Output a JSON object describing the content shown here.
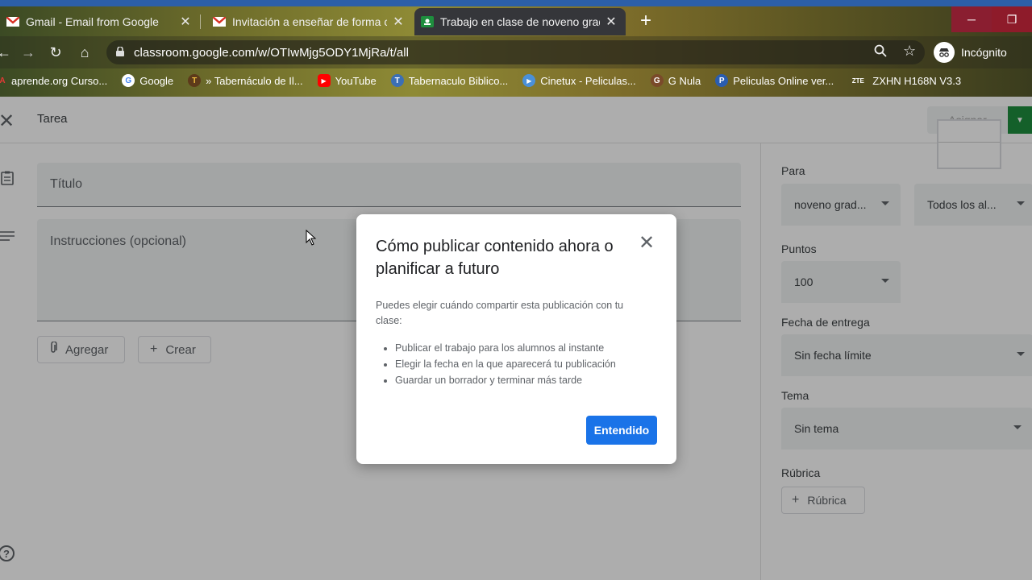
{
  "browser": {
    "tabs": [
      {
        "label": "Gmail - Email from Google",
        "icon": "gmail-icon",
        "close": "✕"
      },
      {
        "label": "Invitación a enseñar de forma co",
        "icon": "gmail-icon",
        "close": "✕"
      },
      {
        "label": "Trabajo en clase de noveno grad",
        "icon": "classroom-icon",
        "close": "✕",
        "active": true
      }
    ],
    "new_tab": "+",
    "url": "classroom.google.com/w/OTIwMjg5ODY1MjRa/t/all",
    "incognito_label": "Incógnito",
    "bookmarks": [
      {
        "label": "aprende.org Curso...",
        "icon": "A"
      },
      {
        "label": "Google",
        "icon": "G"
      },
      {
        "label": "» Tabernáculo de Il...",
        "icon": "T"
      },
      {
        "label": "YouTube",
        "icon": "▶"
      },
      {
        "label": "Tabernaculo Biblico...",
        "icon": "T"
      },
      {
        "label": "Cinetux - Peliculas...",
        "icon": "▶"
      },
      {
        "label": "G Nula",
        "icon": "G"
      },
      {
        "label": "Peliculas Online ver...",
        "icon": "P"
      },
      {
        "label": "ZXHN H168N V3.3",
        "icon": "ZTE"
      }
    ],
    "window_buttons": {
      "minimize": "─",
      "restore": "❐"
    }
  },
  "page": {
    "close_glyph": "✕",
    "title": "Tarea",
    "assign_label": "Asignar",
    "title_placeholder": "Título",
    "instructions_placeholder": "Instrucciones (opcional)",
    "add_label": "Agregar",
    "create_label": "Crear",
    "help_glyph": "?"
  },
  "sidebar": {
    "for_label": "Para",
    "class_value": "noveno grad...",
    "students_value": "Todos los al...",
    "points_label": "Puntos",
    "points_value": "100",
    "due_label": "Fecha de entrega",
    "due_value": "Sin fecha límite",
    "topic_label": "Tema",
    "topic_value": "Sin tema",
    "rubric_label": "Rúbrica",
    "rubric_button": "Rúbrica"
  },
  "dialog": {
    "title": "Cómo publicar contenido ahora o planificar a futuro",
    "close_glyph": "✕",
    "intro": "Puedes elegir cuándo compartir esta publicación con tu clase:",
    "items": [
      "Publicar el trabajo para los alumnos al instante",
      "Elegir la fecha en la que aparecerá tu publicación",
      "Guardar un borrador y terminar más tarde"
    ],
    "ok_label": "Entendido"
  }
}
